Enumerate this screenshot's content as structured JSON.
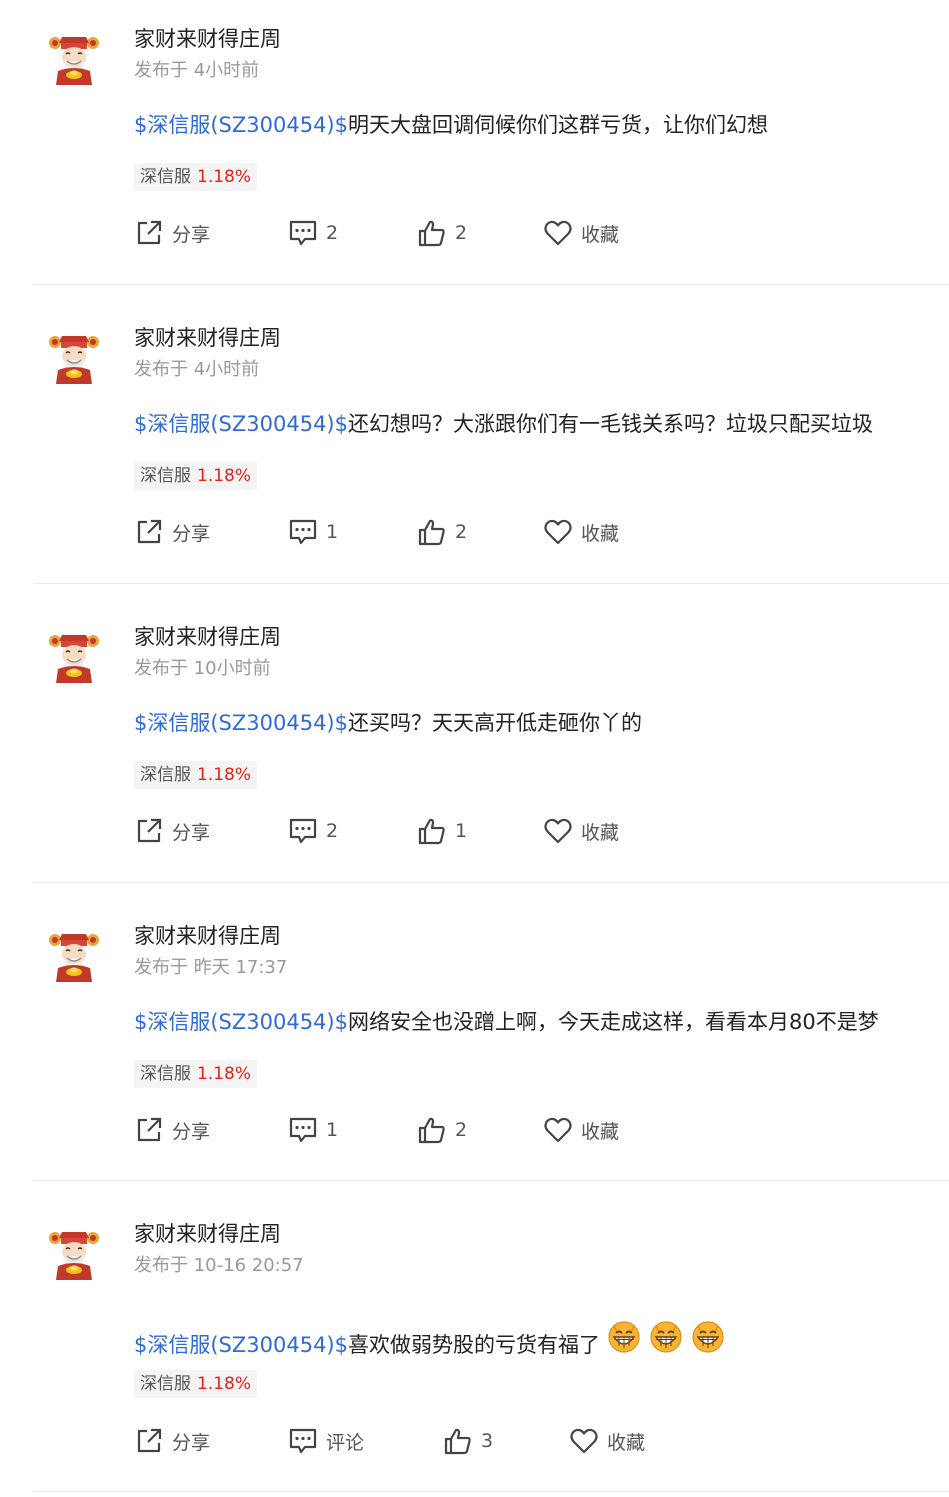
{
  "posts": [
    {
      "username": "家财来财得庄周",
      "meta": "发布于 4小时前",
      "stock_link": "$深信服(SZ300454)$",
      "text": "明天大盘回调伺候你们这群亏货，让你们幻想",
      "emojis": 0,
      "tag": {
        "name": "深信服",
        "change": "1.18%"
      },
      "share_label": "分享",
      "comment_label": "2",
      "like_label": "2",
      "favorite_label": "收藏"
    },
    {
      "username": "家财来财得庄周",
      "meta": "发布于 4小时前",
      "stock_link": "$深信服(SZ300454)$",
      "text": "还幻想吗？大涨跟你们有一毛钱关系吗？垃圾只配买垃圾",
      "emojis": 0,
      "tag": {
        "name": "深信服",
        "change": "1.18%"
      },
      "share_label": "分享",
      "comment_label": "1",
      "like_label": "2",
      "favorite_label": "收藏"
    },
    {
      "username": "家财来财得庄周",
      "meta": "发布于 10小时前",
      "stock_link": "$深信服(SZ300454)$",
      "text": "还买吗？天天高开低走砸你丫的",
      "emojis": 0,
      "tag": {
        "name": "深信服",
        "change": "1.18%"
      },
      "share_label": "分享",
      "comment_label": "2",
      "like_label": "1",
      "favorite_label": "收藏"
    },
    {
      "username": "家财来财得庄周",
      "meta": "发布于 昨天 17:37",
      "stock_link": "$深信服(SZ300454)$",
      "text": "网络安全也没蹭上啊，今天走成这样，看看本月80不是梦",
      "emojis": 0,
      "tag": {
        "name": "深信服",
        "change": "1.18%"
      },
      "share_label": "分享",
      "comment_label": "1",
      "like_label": "2",
      "favorite_label": "收藏"
    },
    {
      "username": "家财来财得庄周",
      "meta": "发布于 10-16 20:57",
      "stock_link": "$深信服(SZ300454)$",
      "text": "喜欢做弱势股的亏货有福了",
      "emojis": 3,
      "tag": {
        "name": "深信服",
        "change": "1.18%"
      },
      "share_label": "分享",
      "comment_label": "评论",
      "like_label": "3",
      "favorite_label": "收藏"
    }
  ],
  "icons": {
    "avatar": "caishen-avatar",
    "share": "share-icon",
    "comment": "comment-icon",
    "like": "thumbs-up-icon",
    "favorite": "heart-icon",
    "emoji": "grin-emoji"
  },
  "colors": {
    "link": "#2f6bd6",
    "gain": "#e0231a",
    "meta": "#999999",
    "divider": "#ececec"
  }
}
